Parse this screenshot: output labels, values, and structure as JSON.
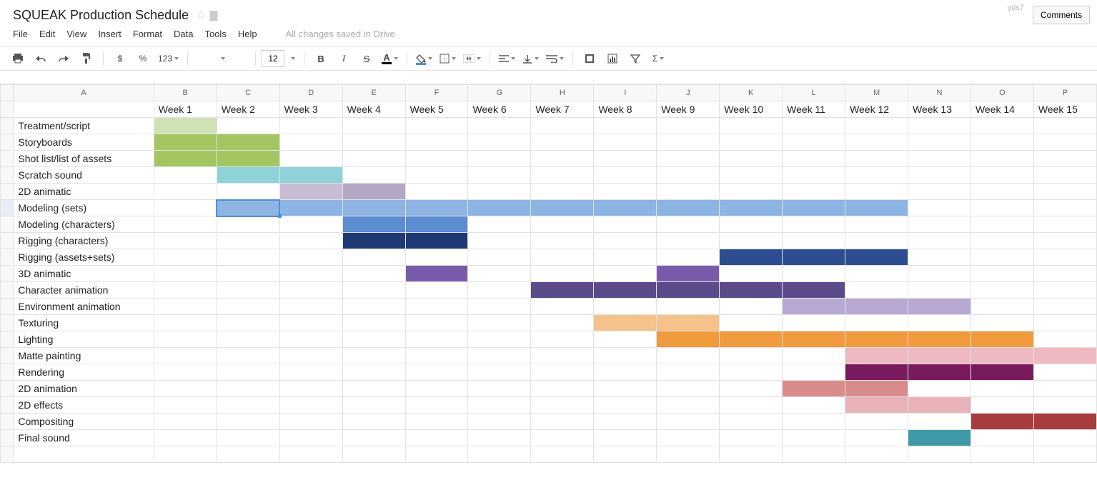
{
  "doc": {
    "title": "SQUEAK Production Schedule",
    "comments_label": "Comments",
    "username": "yds7",
    "drive_status": "All changes saved in Drive"
  },
  "menus": [
    "File",
    "Edit",
    "View",
    "Insert",
    "Format",
    "Data",
    "Tools",
    "Help"
  ],
  "toolbar": {
    "currency_symbol": "$",
    "percent_symbol": "%",
    "num_format_label": "123",
    "font_size": "12",
    "bold": "B",
    "italic": "I",
    "strike": "S",
    "text_color_glyph": "A",
    "sigma": "Σ"
  },
  "columns": [
    "A",
    "B",
    "C",
    "D",
    "E",
    "F",
    "G",
    "H",
    "I",
    "J",
    "K",
    "L",
    "M",
    "N",
    "O",
    "P"
  ],
  "header_row": [
    "",
    "Week 1",
    "Week 2",
    "Week 3",
    "Week 4",
    "Week 5",
    "Week 6",
    "Week 7",
    "Week 8",
    "Week 9",
    "Week 10",
    "Week 11",
    "Week 12",
    "Week 13",
    "Week 14",
    "Week 15"
  ],
  "tasks": [
    {
      "name": "Treatment/script",
      "cells": [
        "c-treat1",
        "",
        "",
        "",
        "",
        "",
        "",
        "",
        "",
        "",
        "",
        "",
        "",
        "",
        ""
      ]
    },
    {
      "name": "Storyboards",
      "cells": [
        "c-story",
        "c-story",
        "",
        "",
        "",
        "",
        "",
        "",
        "",
        "",
        "",
        "",
        "",
        "",
        ""
      ]
    },
    {
      "name": "Shot list/list of assets",
      "cells": [
        "c-story",
        "c-story",
        "",
        "",
        "",
        "",
        "",
        "",
        "",
        "",
        "",
        "",
        "",
        "",
        ""
      ]
    },
    {
      "name": "Scratch sound",
      "cells": [
        "",
        "c-scratch",
        "c-scratch",
        "",
        "",
        "",
        "",
        "",
        "",
        "",
        "",
        "",
        "",
        "",
        ""
      ]
    },
    {
      "name": "2D animatic",
      "cells": [
        "",
        "",
        "c-2dan1",
        "c-2dan2",
        "",
        "",
        "",
        "",
        "",
        "",
        "",
        "",
        "",
        "",
        ""
      ]
    },
    {
      "name": "Modeling (sets)",
      "cells": [
        "",
        "c-msets",
        "c-msets",
        "c-msets",
        "c-msets",
        "c-msets",
        "c-msets",
        "c-msets",
        "c-msets",
        "c-msets",
        "c-msets",
        "c-msets",
        "",
        "",
        ""
      ]
    },
    {
      "name": "Modeling (characters)",
      "cells": [
        "",
        "",
        "",
        "c-mchar",
        "c-mchar",
        "",
        "",
        "",
        "",
        "",
        "",
        "",
        "",
        "",
        ""
      ]
    },
    {
      "name": "Rigging (characters)",
      "cells": [
        "",
        "",
        "",
        "c-rigc",
        "c-rigc",
        "",
        "",
        "",
        "",
        "",
        "",
        "",
        "",
        "",
        ""
      ]
    },
    {
      "name": "Rigging (assets+sets)",
      "cells": [
        "",
        "",
        "",
        "",
        "",
        "",
        "",
        "",
        "",
        "c-riga",
        "c-riga",
        "c-riga",
        "",
        "",
        ""
      ]
    },
    {
      "name": "3D animatic",
      "cells": [
        "",
        "",
        "",
        "",
        "c-3dan",
        "",
        "",
        "",
        "c-3dan",
        "",
        "",
        "",
        "",
        "",
        ""
      ]
    },
    {
      "name": "Character animation",
      "cells": [
        "",
        "",
        "",
        "",
        "",
        "",
        "c-canim",
        "c-canim",
        "c-canim",
        "c-canim",
        "c-canim",
        "",
        "",
        "",
        ""
      ]
    },
    {
      "name": "Environment animation",
      "cells": [
        "",
        "",
        "",
        "",
        "",
        "",
        "",
        "",
        "",
        "",
        "c-env",
        "c-env",
        "c-env",
        "",
        ""
      ]
    },
    {
      "name": "Texturing",
      "cells": [
        "",
        "",
        "",
        "",
        "",
        "",
        "",
        "c-tex",
        "c-tex",
        "",
        "",
        "",
        "",
        "",
        ""
      ]
    },
    {
      "name": "Lighting",
      "cells": [
        "",
        "",
        "",
        "",
        "",
        "",
        "",
        "",
        "c-light",
        "c-light",
        "c-light",
        "c-light",
        "c-light",
        "c-light",
        ""
      ]
    },
    {
      "name": "Matte painting",
      "cells": [
        "",
        "",
        "",
        "",
        "",
        "",
        "",
        "",
        "",
        "",
        "",
        "c-matte",
        "c-matte",
        "c-matte",
        "c-matte"
      ]
    },
    {
      "name": "Rendering",
      "cells": [
        "",
        "",
        "",
        "",
        "",
        "",
        "",
        "",
        "",
        "",
        "",
        "c-rend",
        "c-rend",
        "c-rend",
        ""
      ]
    },
    {
      "name": "2D animation",
      "cells": [
        "",
        "",
        "",
        "",
        "",
        "",
        "",
        "",
        "",
        "",
        "c-2danim",
        "c-2danim",
        "",
        "",
        ""
      ]
    },
    {
      "name": "2D effects",
      "cells": [
        "",
        "",
        "",
        "",
        "",
        "",
        "",
        "",
        "",
        "",
        "",
        "c-2dfx",
        "c-2dfx",
        "",
        ""
      ]
    },
    {
      "name": "Compositing",
      "cells": [
        "",
        "",
        "",
        "",
        "",
        "",
        "",
        "",
        "",
        "",
        "",
        "",
        "",
        "c-comp",
        "c-comp"
      ]
    },
    {
      "name": "Final sound",
      "cells": [
        "",
        "",
        "",
        "",
        "",
        "",
        "",
        "",
        "",
        "",
        "",
        "",
        "c-fsnd",
        "",
        ""
      ]
    }
  ],
  "selected": {
    "col_index": 2,
    "task_index": 5
  }
}
